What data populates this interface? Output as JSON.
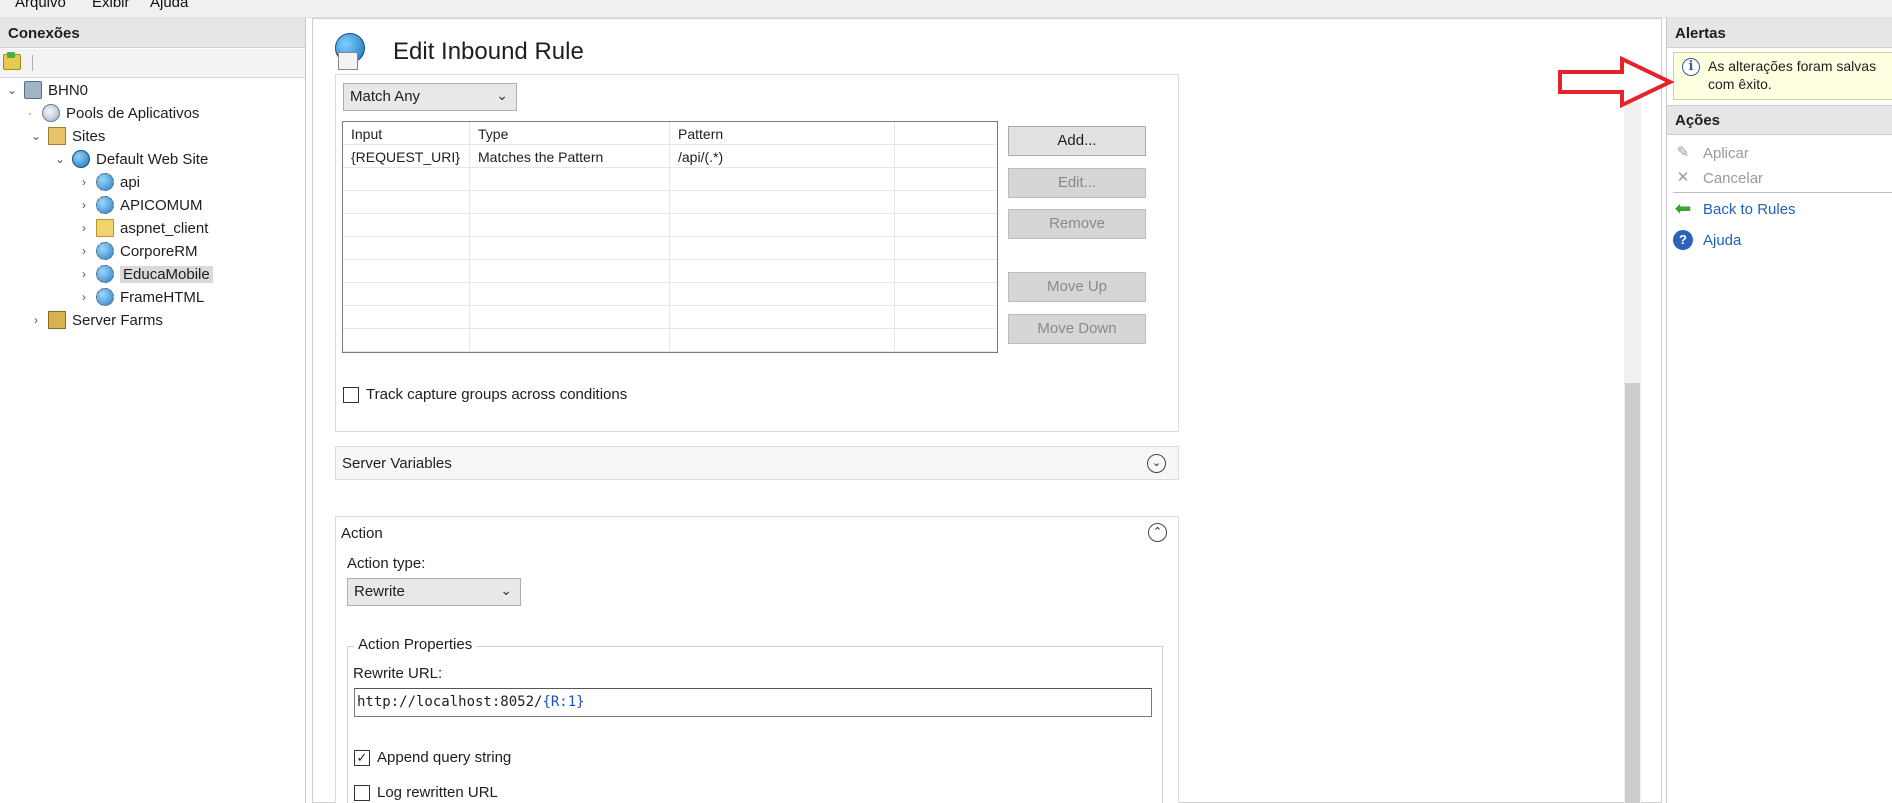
{
  "menu": {
    "items": [
      "Arquivo",
      "Exibir",
      "Ajuda"
    ]
  },
  "connections": {
    "header": "Conexões",
    "tree": [
      {
        "label": "BHN0",
        "icon": "server-icon",
        "expander": "expanded"
      },
      {
        "label": "Pools de Aplicativos",
        "icon": "app-pool-icon",
        "expander": "none"
      },
      {
        "label": "Sites",
        "icon": "sites-folder-icon",
        "expander": "expanded"
      },
      {
        "label": "Default Web Site",
        "icon": "globe-icon",
        "expander": "expanded"
      },
      {
        "label": "api",
        "icon": "application-icon",
        "expander": "collapsed"
      },
      {
        "label": "APICOMUM",
        "icon": "application-icon",
        "expander": "collapsed"
      },
      {
        "label": "aspnet_client",
        "icon": "folder-icon",
        "expander": "collapsed"
      },
      {
        "label": "CorporeRM",
        "icon": "application-icon",
        "expander": "collapsed"
      },
      {
        "label": "EducaMobile",
        "icon": "application-icon",
        "expander": "collapsed",
        "selected": true
      },
      {
        "label": "FrameHTML",
        "icon": "application-icon",
        "expander": "collapsed"
      },
      {
        "label": "Server Farms",
        "icon": "server-farm-icon",
        "expander": "collapsed"
      }
    ]
  },
  "main": {
    "title": "Edit Inbound Rule",
    "logical_grouping": "Match Any",
    "conditions": {
      "columns": [
        "Input",
        "Type",
        "Pattern"
      ],
      "rows": [
        {
          "input": "{REQUEST_URI}",
          "type": "Matches the Pattern",
          "pattern": "/api/(.*)"
        }
      ]
    },
    "buttons": {
      "add": "Add...",
      "edit": "Edit...",
      "remove": "Remove",
      "move_up": "Move Up",
      "move_down": "Move Down"
    },
    "track_capture": {
      "label": "Track capture groups across conditions",
      "checked": false
    },
    "server_variables": "Server Variables",
    "action": {
      "section_title": "Action",
      "type_label": "Action type:",
      "type_value": "Rewrite",
      "properties_legend": "Action Properties",
      "rewrite_url_label": "Rewrite URL:",
      "rewrite_url_prefix": "http://localhost:8052/",
      "rewrite_url_var": "{R:1}",
      "append_query": {
        "label": "Append query string",
        "checked": true
      },
      "log_rewritten": {
        "label": "Log rewritten URL",
        "checked": false
      }
    }
  },
  "alerts": {
    "header": "Alertas",
    "message": "As alterações foram salvas com êxito."
  },
  "actions": {
    "header": "Ações",
    "items": [
      {
        "label": "Aplicar",
        "icon": "apply-icon",
        "enabled": false
      },
      {
        "label": "Cancelar",
        "icon": "cancel-icon",
        "enabled": false
      },
      {
        "label": "Back to Rules",
        "icon": "back-arrow-icon",
        "enabled": true
      },
      {
        "label": "Ajuda",
        "icon": "help-icon",
        "enabled": true
      }
    ]
  },
  "colors": {
    "link": "#1e63b7",
    "alert_background": "#ffffe1",
    "annotation_arrow": "#e3242b"
  }
}
